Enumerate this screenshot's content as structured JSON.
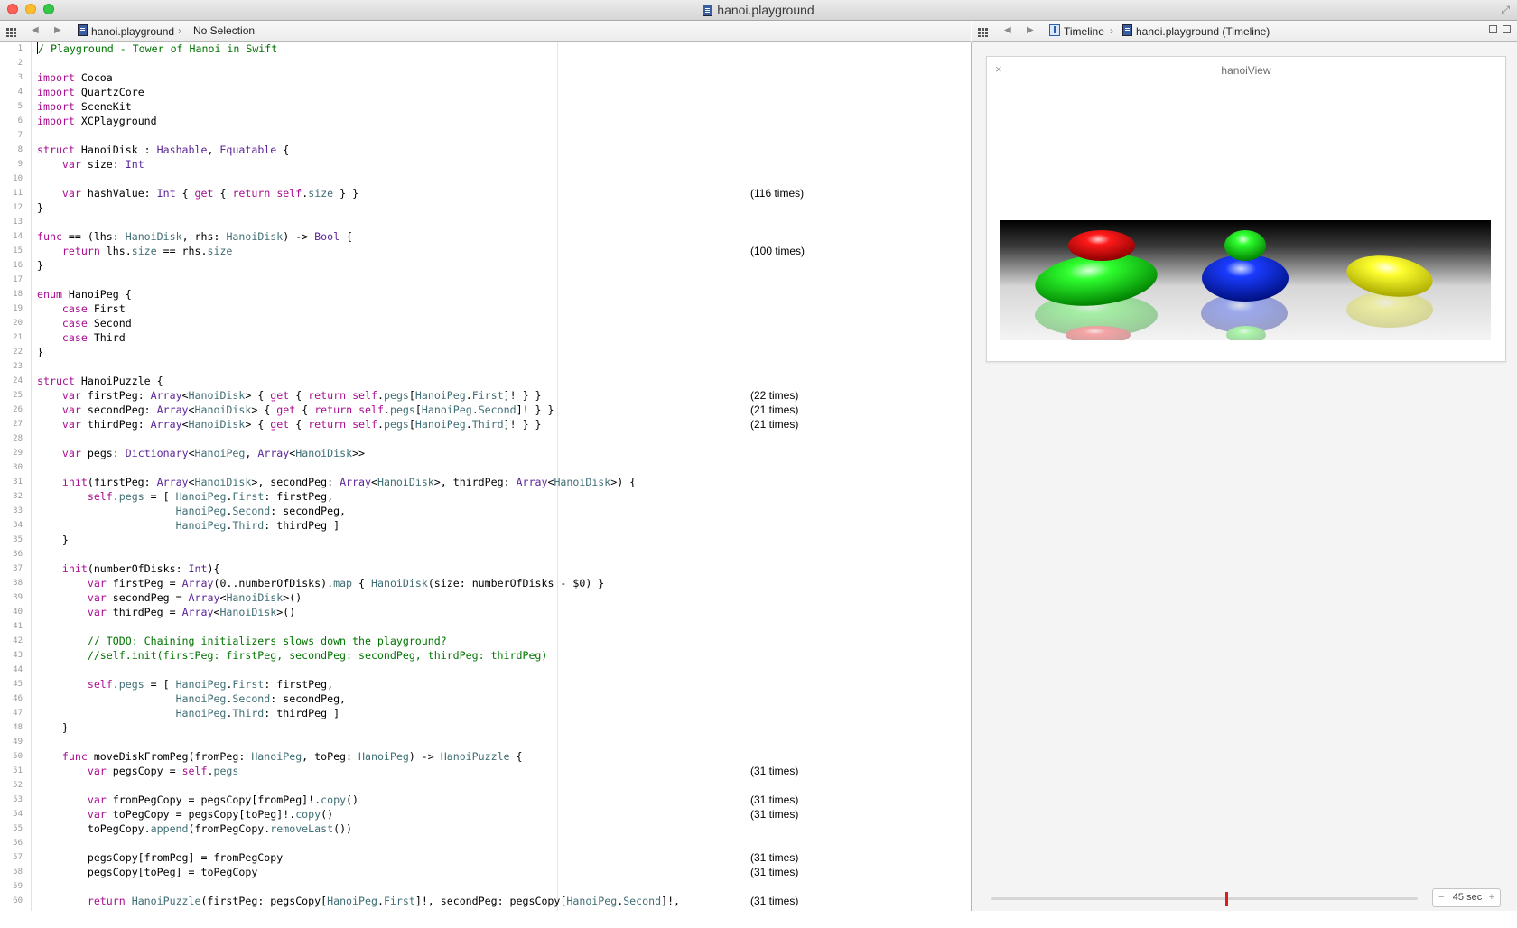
{
  "window": {
    "title": "hanoi.playground"
  },
  "left_jumpbar": {
    "file": "hanoi.playground",
    "selection": "No Selection"
  },
  "right_jumpbar": {
    "mode": "Timeline",
    "file": "hanoi.playground (Timeline)"
  },
  "editor": {
    "lines": [
      {
        "n": "1",
        "html": "<span class=\"cursor\"></span><span class=\"cm\">/ Playground - Tower of Hanoi in Swift</span>",
        "r": ""
      },
      {
        "n": "2",
        "html": "",
        "r": ""
      },
      {
        "n": "3",
        "html": "<span class=\"kw\">import</span> Cocoa",
        "r": ""
      },
      {
        "n": "4",
        "html": "<span class=\"kw\">import</span> QuartzCore",
        "r": ""
      },
      {
        "n": "5",
        "html": "<span class=\"kw\">import</span> SceneKit",
        "r": ""
      },
      {
        "n": "6",
        "html": "<span class=\"kw\">import</span> XCPlayground",
        "r": ""
      },
      {
        "n": "7",
        "html": "",
        "r": ""
      },
      {
        "n": "8",
        "html": "<span class=\"kw\">struct</span> HanoiDisk : <span class=\"ty\">Hashable</span>, <span class=\"ty\">Equatable</span> {",
        "r": ""
      },
      {
        "n": "9",
        "html": "    <span class=\"kw\">var</span> size: <span class=\"ty\">Int</span>",
        "r": ""
      },
      {
        "n": "10",
        "html": "",
        "r": ""
      },
      {
        "n": "11",
        "html": "    <span class=\"kw\">var</span> hashValue: <span class=\"ty\">Int</span> { <span class=\"kw\">get</span> { <span class=\"kw\">return</span> <span class=\"kw\">self</span>.<span class=\"nm\">size</span> } }",
        "r": "(116 times)"
      },
      {
        "n": "12",
        "html": "}",
        "r": ""
      },
      {
        "n": "13",
        "html": "",
        "r": ""
      },
      {
        "n": "14",
        "html": "<span class=\"kw\">func</span> == (lhs: <span class=\"nm\">HanoiDisk</span>, rhs: <span class=\"nm\">HanoiDisk</span>) -> <span class=\"ty\">Bool</span> {",
        "r": ""
      },
      {
        "n": "15",
        "html": "    <span class=\"kw\">return</span> lhs.<span class=\"nm\">size</span> == rhs.<span class=\"nm\">size</span>",
        "r": "(100 times)"
      },
      {
        "n": "16",
        "html": "}",
        "r": ""
      },
      {
        "n": "17",
        "html": "",
        "r": ""
      },
      {
        "n": "18",
        "html": "<span class=\"kw\">enum</span> HanoiPeg {",
        "r": ""
      },
      {
        "n": "19",
        "html": "    <span class=\"kw\">case</span> First",
        "r": ""
      },
      {
        "n": "20",
        "html": "    <span class=\"kw\">case</span> Second",
        "r": ""
      },
      {
        "n": "21",
        "html": "    <span class=\"kw\">case</span> Third",
        "r": ""
      },
      {
        "n": "22",
        "html": "}",
        "r": ""
      },
      {
        "n": "23",
        "html": "",
        "r": ""
      },
      {
        "n": "24",
        "html": "<span class=\"kw\">struct</span> HanoiPuzzle {",
        "r": ""
      },
      {
        "n": "25",
        "html": "    <span class=\"kw\">var</span> firstPeg: <span class=\"ty\">Array</span>&lt;<span class=\"nm\">HanoiDisk</span>&gt; { <span class=\"kw\">get</span> { <span class=\"kw\">return</span> <span class=\"kw\">self</span>.<span class=\"nm\">pegs</span>[<span class=\"nm\">HanoiPeg</span>.<span class=\"nm\">First</span>]! } }",
        "r": "(22 times)"
      },
      {
        "n": "26",
        "html": "    <span class=\"kw\">var</span> secondPeg: <span class=\"ty\">Array</span>&lt;<span class=\"nm\">HanoiDisk</span>&gt; { <span class=\"kw\">get</span> { <span class=\"kw\">return</span> <span class=\"kw\">self</span>.<span class=\"nm\">pegs</span>[<span class=\"nm\">HanoiPeg</span>.<span class=\"nm\">Second</span>]! } }",
        "r": "(21 times)"
      },
      {
        "n": "27",
        "html": "    <span class=\"kw\">var</span> thirdPeg: <span class=\"ty\">Array</span>&lt;<span class=\"nm\">HanoiDisk</span>&gt; { <span class=\"kw\">get</span> { <span class=\"kw\">return</span> <span class=\"kw\">self</span>.<span class=\"nm\">pegs</span>[<span class=\"nm\">HanoiPeg</span>.<span class=\"nm\">Third</span>]! } }",
        "r": "(21 times)"
      },
      {
        "n": "28",
        "html": "",
        "r": ""
      },
      {
        "n": "29",
        "html": "    <span class=\"kw\">var</span> pegs: <span class=\"ty\">Dictionary</span>&lt;<span class=\"nm\">HanoiPeg</span>, <span class=\"ty\">Array</span>&lt;<span class=\"nm\">HanoiDisk</span>&gt;&gt;",
        "r": ""
      },
      {
        "n": "30",
        "html": "",
        "r": ""
      },
      {
        "n": "31",
        "html": "    <span class=\"kw\">init</span>(firstPeg: <span class=\"ty\">Array</span>&lt;<span class=\"nm\">HanoiDisk</span>&gt;, secondPeg: <span class=\"ty\">Array</span>&lt;<span class=\"nm\">HanoiDisk</span>&gt;, thirdPeg: <span class=\"ty\">Array</span>&lt;<span class=\"nm\">HanoiDisk</span>&gt;) {",
        "r": ""
      },
      {
        "n": "32",
        "html": "        <span class=\"kw\">self</span>.<span class=\"nm\">pegs</span> = [ <span class=\"nm\">HanoiPeg</span>.<span class=\"nm\">First</span>: firstPeg,",
        "r": ""
      },
      {
        "n": "33",
        "html": "                      <span class=\"nm\">HanoiPeg</span>.<span class=\"nm\">Second</span>: secondPeg,",
        "r": ""
      },
      {
        "n": "34",
        "html": "                      <span class=\"nm\">HanoiPeg</span>.<span class=\"nm\">Third</span>: thirdPeg ]",
        "r": ""
      },
      {
        "n": "35",
        "html": "    }",
        "r": ""
      },
      {
        "n": "36",
        "html": "",
        "r": ""
      },
      {
        "n": "37",
        "html": "    <span class=\"kw\">init</span>(numberOfDisks: <span class=\"ty\">Int</span>){",
        "r": ""
      },
      {
        "n": "38",
        "html": "        <span class=\"kw\">var</span> firstPeg = <span class=\"ty\">Array</span>(0..numberOfDisks).<span class=\"nm\">map</span> { <span class=\"nm\">HanoiDisk</span>(size: numberOfDisks - $0) }",
        "r": ""
      },
      {
        "n": "39",
        "html": "        <span class=\"kw\">var</span> secondPeg = <span class=\"ty\">Array</span>&lt;<span class=\"nm\">HanoiDisk</span>&gt;()",
        "r": ""
      },
      {
        "n": "40",
        "html": "        <span class=\"kw\">var</span> thirdPeg = <span class=\"ty\">Array</span>&lt;<span class=\"nm\">HanoiDisk</span>&gt;()",
        "r": ""
      },
      {
        "n": "41",
        "html": "",
        "r": ""
      },
      {
        "n": "42",
        "html": "        <span class=\"cm\">// TODO: Chaining initializers slows down the playground?</span>",
        "r": ""
      },
      {
        "n": "43",
        "html": "        <span class=\"cm\">//self.init(firstPeg: firstPeg, secondPeg: secondPeg, thirdPeg: thirdPeg)</span>",
        "r": ""
      },
      {
        "n": "44",
        "html": "",
        "r": ""
      },
      {
        "n": "45",
        "html": "        <span class=\"kw\">self</span>.<span class=\"nm\">pegs</span> = [ <span class=\"nm\">HanoiPeg</span>.<span class=\"nm\">First</span>: firstPeg,",
        "r": ""
      },
      {
        "n": "46",
        "html": "                      <span class=\"nm\">HanoiPeg</span>.<span class=\"nm\">Second</span>: secondPeg,",
        "r": ""
      },
      {
        "n": "47",
        "html": "                      <span class=\"nm\">HanoiPeg</span>.<span class=\"nm\">Third</span>: thirdPeg ]",
        "r": ""
      },
      {
        "n": "48",
        "html": "    }",
        "r": ""
      },
      {
        "n": "49",
        "html": "",
        "r": ""
      },
      {
        "n": "50",
        "html": "    <span class=\"kw\">func</span> moveDiskFromPeg(fromPeg: <span class=\"nm\">HanoiPeg</span>, toPeg: <span class=\"nm\">HanoiPeg</span>) -> <span class=\"nm\">HanoiPuzzle</span> {",
        "r": ""
      },
      {
        "n": "51",
        "html": "        <span class=\"kw\">var</span> pegsCopy = <span class=\"kw\">self</span>.<span class=\"nm\">pegs</span>",
        "r": "(31 times)"
      },
      {
        "n": "52",
        "html": "",
        "r": ""
      },
      {
        "n": "53",
        "html": "        <span class=\"kw\">var</span> fromPegCopy = pegsCopy[fromPeg]!.<span class=\"nm\">copy</span>()",
        "r": "(31 times)"
      },
      {
        "n": "54",
        "html": "        <span class=\"kw\">var</span> toPegCopy = pegsCopy[toPeg]!.<span class=\"nm\">copy</span>()",
        "r": "(31 times)"
      },
      {
        "n": "55",
        "html": "        toPegCopy.<span class=\"nm\">append</span>(fromPegCopy.<span class=\"nm\">removeLast</span>())",
        "r": ""
      },
      {
        "n": "56",
        "html": "",
        "r": ""
      },
      {
        "n": "57",
        "html": "        pegsCopy[fromPeg] = fromPegCopy",
        "r": "(31 times)"
      },
      {
        "n": "58",
        "html": "        pegsCopy[toPeg] = toPegCopy",
        "r": "(31 times)"
      },
      {
        "n": "59",
        "html": "",
        "r": ""
      },
      {
        "n": "60",
        "html": "        <span class=\"kw\">return</span> <span class=\"nm\">HanoiPuzzle</span>(firstPeg: pegsCopy[<span class=\"nm\">HanoiPeg</span>.<span class=\"nm\">First</span>]!, secondPeg: pegsCopy[<span class=\"nm\">HanoiPeg</span>.<span class=\"nm\">Second</span>]!,",
        "r": "(31 times)"
      }
    ]
  },
  "timeline": {
    "view_title": "hanoiView",
    "close_glyph": "×",
    "duration": "45 sec",
    "minus": "−",
    "plus": "+",
    "position_fraction": 0.55
  },
  "colors": {
    "keyword": "#aa0d91",
    "type": "#5c2699",
    "identifier": "#3f6e74",
    "comment": "#007400",
    "scrubber": "#d9201c"
  },
  "icons": [
    "close-light",
    "minimize-light",
    "zoom-light",
    "fullscreen-icon",
    "grid-icon",
    "back-arrow-icon",
    "forward-arrow-icon",
    "playground-file-icon",
    "timeline-icon"
  ]
}
